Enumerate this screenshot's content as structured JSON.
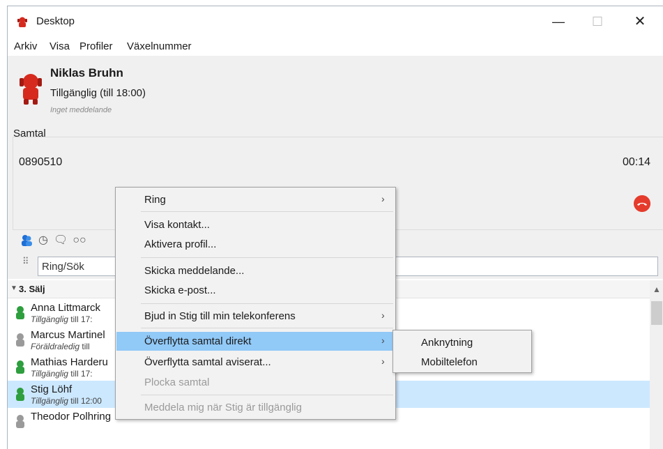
{
  "window": {
    "title": "Desktop",
    "min_glyph": "—",
    "max_glyph": "☐",
    "close_glyph": "✕"
  },
  "menubar": [
    "Arkiv",
    "Visa",
    "Profiler",
    "Växelnummer"
  ],
  "profile": {
    "name": "Niklas Bruhn",
    "status": "Tillgänglig (till 18:00)",
    "message": "Inget meddelande"
  },
  "calls": {
    "label": "Samtal",
    "number": "0890510",
    "duration": "00:14"
  },
  "search": {
    "placeholder": "Ring/Sök"
  },
  "group": {
    "name": "3. Sälj"
  },
  "contacts": [
    {
      "name": "Anna Littmarck",
      "status": "Tillgänglig",
      "detail": "till 17:",
      "color": "#2e9e3e"
    },
    {
      "name": "Marcus Martinel",
      "status": "Föräldraledig",
      "detail": "till",
      "color": "#9a9a9a"
    },
    {
      "name": "Mathias Harderu",
      "status": "Tillgänglig",
      "detail": "till 17:",
      "color": "#2e9e3e"
    },
    {
      "name": "Stig Löhf",
      "status": "Tillgänglig",
      "detail": "till 12:00",
      "color": "#2e9e3e"
    },
    {
      "name": "Theodor Polhring",
      "status": "",
      "detail": "",
      "color": "#9a9a9a"
    }
  ],
  "context_menu": {
    "ring": "Ring",
    "visa_kontakt": "Visa kontakt...",
    "aktivera_profil": "Aktivera profil...",
    "skicka_meddelande": "Skicka meddelande...",
    "skicka_epost": "Skicka e-post...",
    "bjud_in": "Bjud in Stig till min telekonferens",
    "overflytta_direkt": "Överflytta samtal direkt",
    "overflytta_aviserat": "Överflytta samtal aviserat...",
    "plocka": "Plocka samtal",
    "meddela": "Meddela mig när Stig är tillgänglig"
  },
  "submenu": {
    "anknytning": "Anknytning",
    "mobiltelefon": "Mobiltelefon"
  },
  "colors": {
    "accent_highlight": "#91c9f7",
    "selected_row": "#cce8ff",
    "hangup": "#e53b2c",
    "avatar_red": "#d62a1e"
  }
}
